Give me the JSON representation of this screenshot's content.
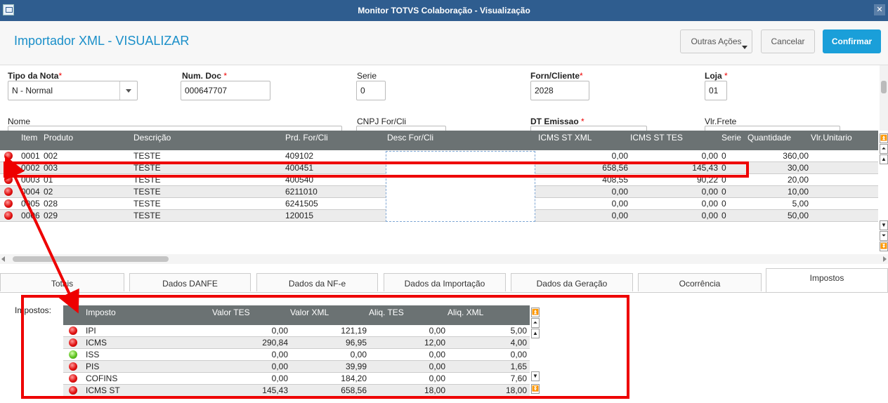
{
  "window": {
    "title": "Monitor TOTVS Colaboração - Visualização",
    "close_glyph": "✕"
  },
  "header": {
    "title": "Importador XML - VISUALIZAR",
    "more_actions": "Outras Ações",
    "cancel": "Cancelar",
    "confirm": "Confirmar"
  },
  "form": {
    "tipo_nota": {
      "label": "Tipo da Nota",
      "value": "N - Normal"
    },
    "num_doc": {
      "label": "Num. Doc",
      "value": "000647707"
    },
    "serie": {
      "label": "Serie",
      "value": "0"
    },
    "forn_cliente": {
      "label": "Forn/Cliente",
      "value": "2028"
    },
    "loja": {
      "label": "Loja",
      "value": "01"
    },
    "nome": {
      "label": "Nome"
    },
    "cnpj": {
      "label": "CNPJ For/Cli"
    },
    "dt_emissao": {
      "label": "DT Emissao"
    },
    "vlr_frete": {
      "label": "Vlr.Frete"
    },
    "required_mark": "*"
  },
  "items_grid": {
    "columns": [
      "Item",
      "Produto",
      "Descrição",
      "Prd. For/Cli",
      "Desc For/Cli",
      "ICMS ST XML",
      "ICMS ST TES",
      "Serie",
      "Quantidade",
      "Vlr.Unitario"
    ],
    "rows": [
      {
        "status": "red",
        "item": "0001",
        "produto": "002",
        "descricao": "TESTE",
        "prd_for": "409102",
        "desc_for": "",
        "icms_st_xml": "0,00",
        "icms_st_tes": "0,00",
        "serie": "0",
        "quantidade": "360,00"
      },
      {
        "status": "red",
        "item": "0002",
        "produto": "003",
        "descricao": "TESTE",
        "prd_for": "400451",
        "desc_for": "",
        "icms_st_xml": "658,56",
        "icms_st_tes": "145,43",
        "serie": "0",
        "quantidade": "30,00"
      },
      {
        "status": "red",
        "item": "0003",
        "produto": "01",
        "descricao": "TESTE",
        "prd_for": "400540",
        "desc_for": "",
        "icms_st_xml": "408,55",
        "icms_st_tes": "90,22",
        "serie": "0",
        "quantidade": "20,00"
      },
      {
        "status": "red",
        "item": "0004",
        "produto": "02",
        "descricao": "TESTE",
        "prd_for": "6211010",
        "desc_for": "",
        "icms_st_xml": "0,00",
        "icms_st_tes": "0,00",
        "serie": "0",
        "quantidade": "10,00"
      },
      {
        "status": "red",
        "item": "0005",
        "produto": "028",
        "descricao": "TESTE",
        "prd_for": "6241505",
        "desc_for": "",
        "icms_st_xml": "0,00",
        "icms_st_tes": "0,00",
        "serie": "0",
        "quantidade": "5,00"
      },
      {
        "status": "red",
        "item": "0006",
        "produto": "029",
        "descricao": "TESTE",
        "prd_for": "120015",
        "desc_for": "",
        "icms_st_xml": "0,00",
        "icms_st_tes": "0,00",
        "serie": "0",
        "quantidade": "50,00"
      }
    ]
  },
  "tabs": [
    "Totais",
    "Dados DANFE",
    "Dados da NF-e",
    "Dados da Importação",
    "Dados da Geração",
    "Ocorrência",
    "Impostos"
  ],
  "active_tab": "Impostos",
  "impostos": {
    "label": "Impostos:",
    "columns": [
      "Imposto",
      "Valor TES",
      "Valor XML",
      "Aliq. TES",
      "Aliq. XML"
    ],
    "rows": [
      {
        "status": "red",
        "imposto": "IPI",
        "valor_tes": "0,00",
        "valor_xml": "121,19",
        "aliq_tes": "0,00",
        "aliq_xml": "5,00"
      },
      {
        "status": "red",
        "imposto": "ICMS",
        "valor_tes": "290,84",
        "valor_xml": "96,95",
        "aliq_tes": "12,00",
        "aliq_xml": "4,00"
      },
      {
        "status": "green",
        "imposto": "ISS",
        "valor_tes": "0,00",
        "valor_xml": "0,00",
        "aliq_tes": "0,00",
        "aliq_xml": "0,00"
      },
      {
        "status": "red",
        "imposto": "PIS",
        "valor_tes": "0,00",
        "valor_xml": "39,99",
        "aliq_tes": "0,00",
        "aliq_xml": "1,65"
      },
      {
        "status": "red",
        "imposto": "COFINS",
        "valor_tes": "0,00",
        "valor_xml": "184,20",
        "aliq_tes": "0,00",
        "aliq_xml": "7,60"
      },
      {
        "status": "red",
        "imposto": "ICMS ST",
        "valor_tes": "145,43",
        "valor_xml": "658,56",
        "aliq_tes": "18,00",
        "aliq_xml": "18,00"
      }
    ]
  },
  "colors": {
    "titlebar": "#2f5d8f",
    "accent": "#1a9fd9",
    "grid_header": "#6b7273",
    "annotation": "#e00000"
  }
}
